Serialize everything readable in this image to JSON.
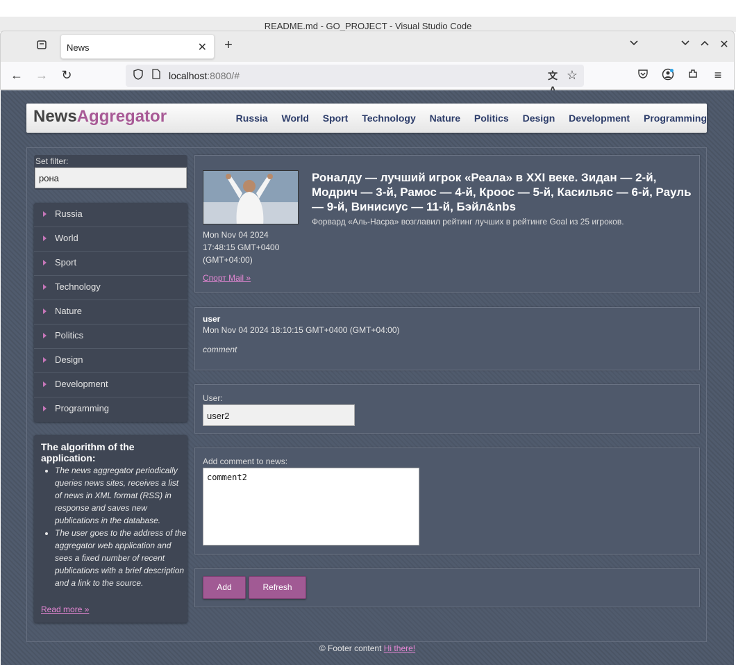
{
  "window": {
    "title": "README.md - GO_PROJECT - Visual Studio Code"
  },
  "browser": {
    "tab_title": "News",
    "url_host": "localhost",
    "url_rest": ":8080/#"
  },
  "site": {
    "logo_a": "News",
    "logo_b": "Aggregator",
    "menu": [
      "Russia",
      "World",
      "Sport",
      "Technology",
      "Nature",
      "Politics",
      "Design",
      "Development",
      "Programming"
    ]
  },
  "filter": {
    "label": "Set filter:",
    "value": "рона"
  },
  "categories": [
    "Russia",
    "World",
    "Sport",
    "Technology",
    "Nature",
    "Politics",
    "Design",
    "Development",
    "Programming"
  ],
  "algo": {
    "title": "The algorithm of the application:",
    "items": [
      "The news aggregator periodically queries news sites, receives a list of news in XML format (RSS) in response and saves new publications in the database.",
      "The user goes to the address of the aggregator web application and sees a fixed number of recent publications with a brief description and a link to the source."
    ],
    "read_more": "Read more »"
  },
  "news": {
    "title": "Роналду — лучший игрок «Реала» в XXI веке. Зидан — 2-й, Модрич — 3-й, Рамос — 4-й, Кроос — 5-й, Касильяс — 6-й, Рауль — 9-й, Винисиус — 11-й, Бэйл&nbs",
    "description": "Форвард «Аль-Насра» возглавил рейтинг лучших в рейтинге Goal из 25 игроков.",
    "date": "Mon Nov 04 2024 17:48:15 GMT+0400 (GMT+04:00)",
    "source": "Спорт Mail »"
  },
  "comment": {
    "user": "user",
    "date": "Mon Nov 04 2024 18:10:15 GMT+0400 (GMT+04:00)",
    "text": "comment"
  },
  "form": {
    "user_label": "User:",
    "user_value": "user2",
    "comment_label": "Add comment to news:",
    "comment_value": "comment2",
    "add": "Add",
    "refresh": "Refresh"
  },
  "footer": {
    "text": "© Footer content ",
    "link": "Hi there!"
  }
}
